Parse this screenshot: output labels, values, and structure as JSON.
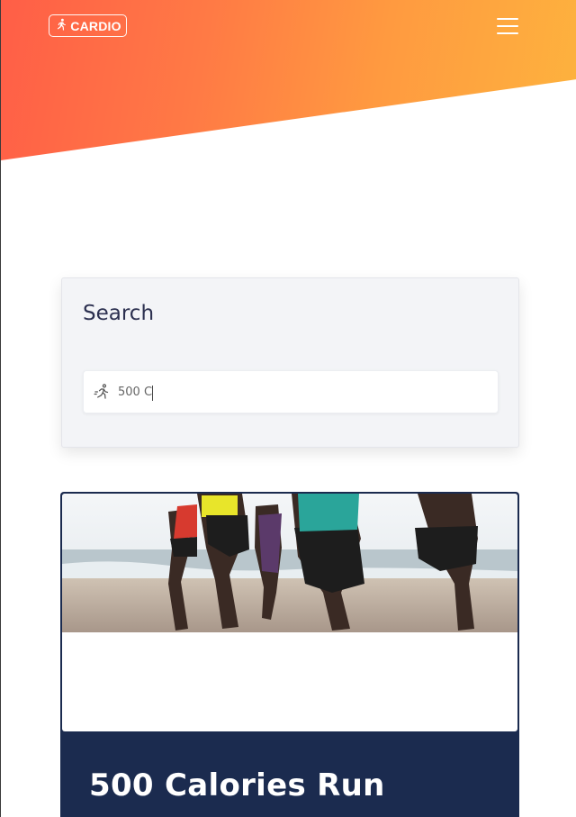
{
  "header": {
    "logo_text": "CARDIO",
    "logo_icon": "runner-icon",
    "menu_icon": "hamburger-menu-icon",
    "gradient_colors": [
      "#ff5e47",
      "#fdb33e"
    ]
  },
  "search": {
    "title": "Search",
    "input_value": "500 C",
    "input_icon": "runner-icon"
  },
  "result": {
    "title": "500 Calories Run",
    "image_alt": "runners-on-beach-photo",
    "card_color": "#1b2b4f"
  }
}
